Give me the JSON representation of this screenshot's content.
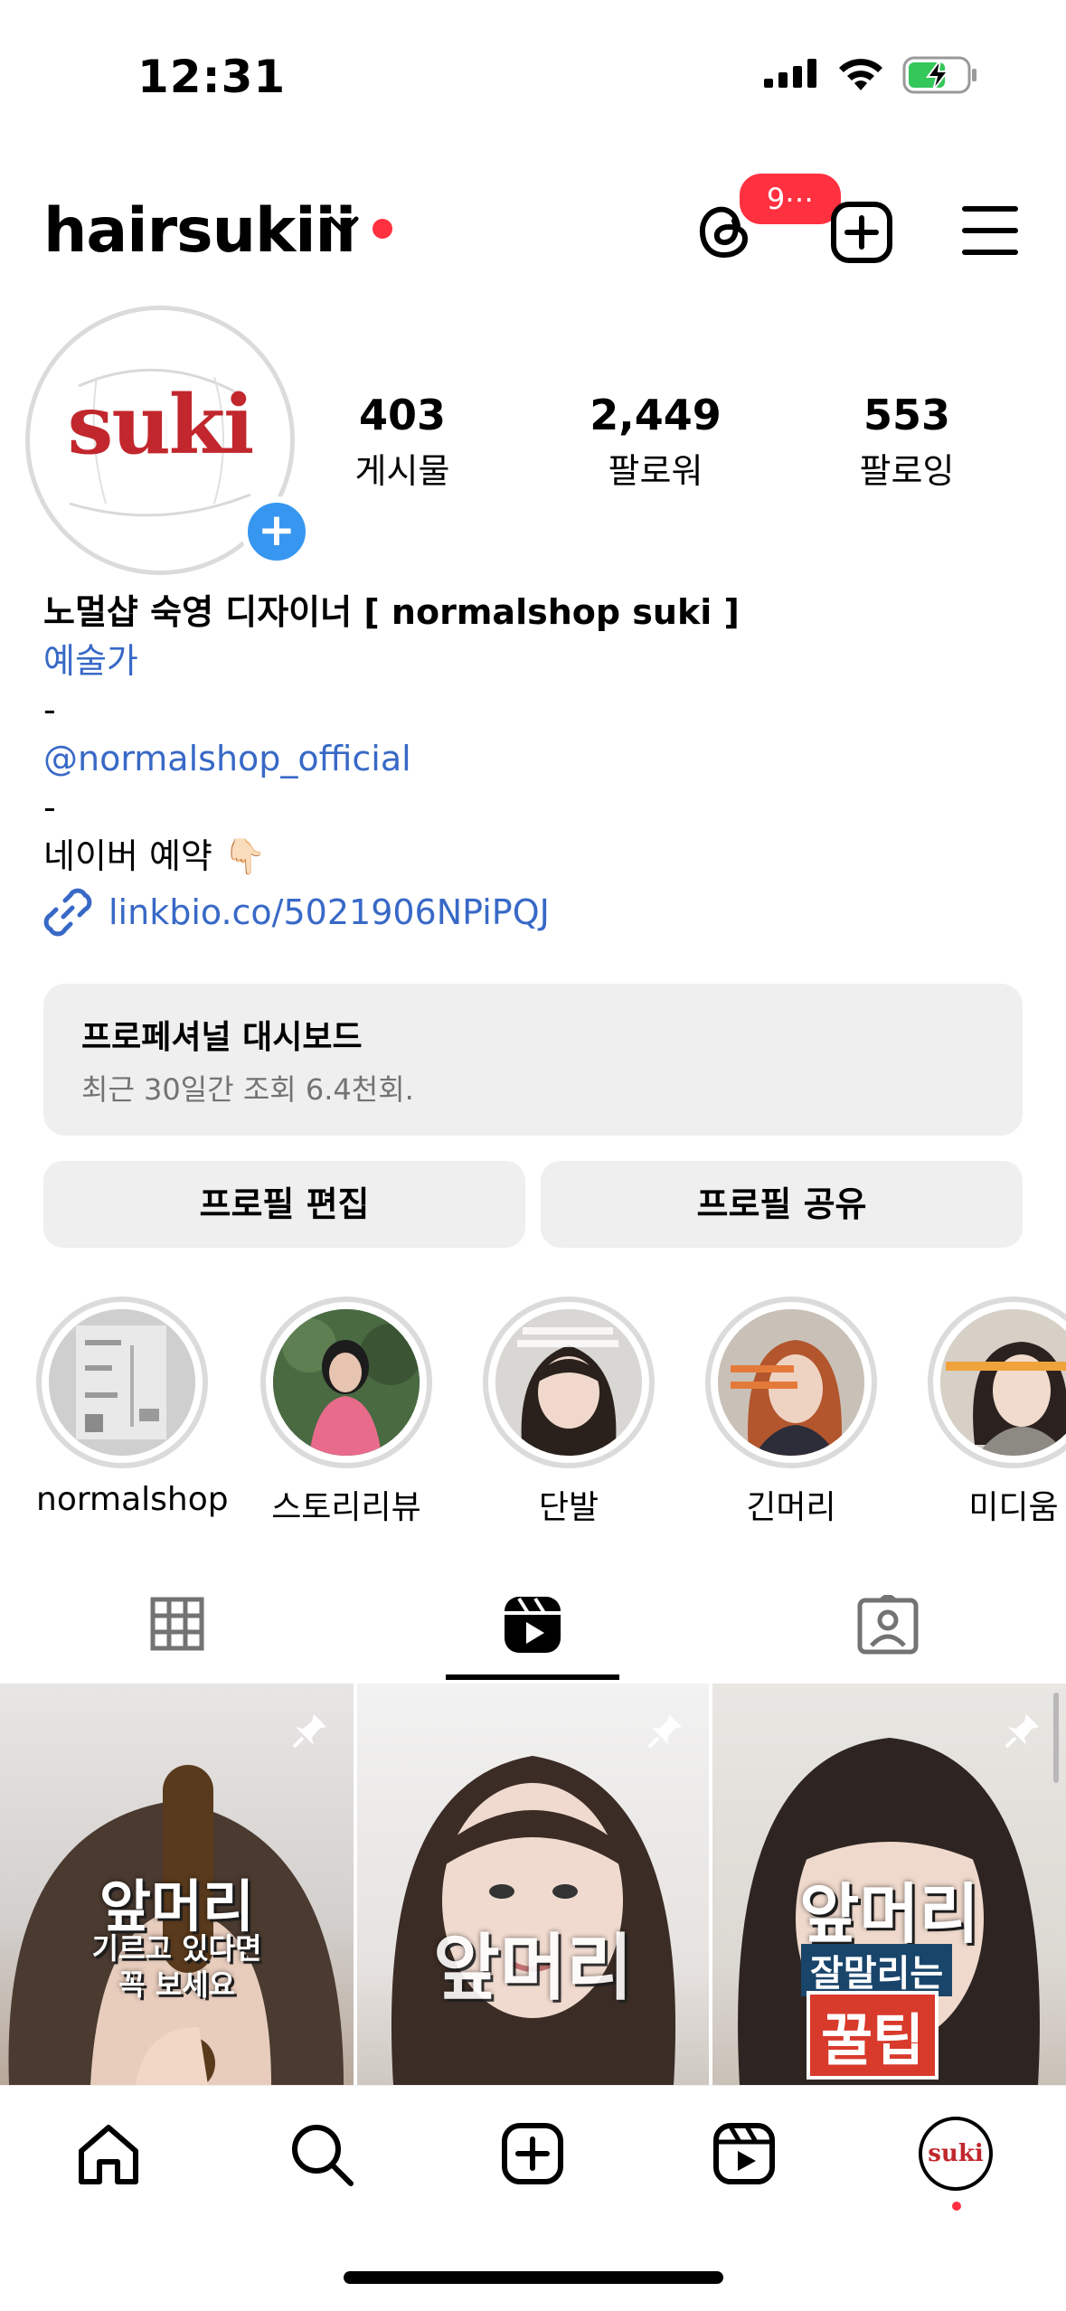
{
  "status_bar": {
    "time": "12:31"
  },
  "header": {
    "username": "hairsukiii",
    "notification_count": "9⋯"
  },
  "profile": {
    "avatar_text": "suki",
    "stats": {
      "posts": {
        "value": "403",
        "label": "게시물"
      },
      "followers": {
        "value": "2,449",
        "label": "팔로워"
      },
      "following": {
        "value": "553",
        "label": "팔로잉"
      }
    },
    "bio": {
      "name": "노멀샵 숙영 디자이너 [ normalshop suki ]",
      "category": "예술가",
      "line_dash_1": "-",
      "mention": "@normalshop_official",
      "line_dash_2": "-",
      "reserve": "네이버 예약 👇🏻",
      "link": "linkbio.co/5021906NPiPQJ"
    }
  },
  "dashboard": {
    "title": "프로페셔널 대시보드",
    "subtitle": "최근 30일간 조회 6.4천회."
  },
  "buttons": {
    "edit": "프로필 편집",
    "share": "프로필 공유"
  },
  "highlights": [
    {
      "label": "normalshop"
    },
    {
      "label": "스토리리뷰"
    },
    {
      "label": "단발"
    },
    {
      "label": "긴머리"
    },
    {
      "label": "미디움"
    }
  ],
  "tabs": {
    "active": "reels"
  },
  "grid": [
    {
      "line1": "앞머리",
      "line2": "기르고 있다면",
      "line3": "꼭 보세요"
    },
    {
      "line1": "앞머리"
    },
    {
      "line1": "앞머리",
      "line2": "잘말리는",
      "line3": "꿀팁"
    }
  ],
  "colors": {
    "accent_blue": "#3797f0",
    "link_blue": "#3869c7",
    "badge_red": "#ff3040",
    "button_bg": "#efefef"
  }
}
